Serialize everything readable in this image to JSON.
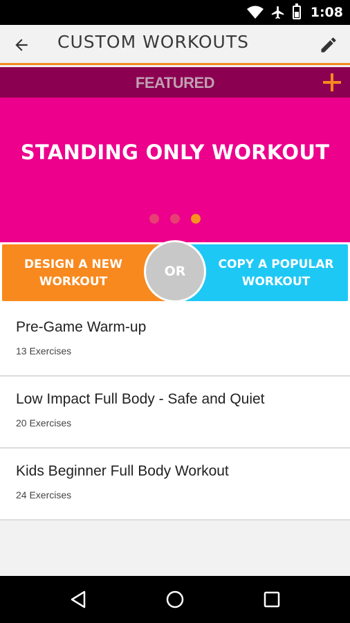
{
  "status_bar": {
    "time": "1:08",
    "icons": [
      "wifi-icon",
      "airplane-icon",
      "battery-icon"
    ]
  },
  "toolbar": {
    "title": "CUSTOM WORKOUTS",
    "back_icon": "arrow-left-icon",
    "edit_icon": "pencil-icon"
  },
  "featured": {
    "label": "FEATURED",
    "add_icon": "plus-icon",
    "banner_title": "STANDING ONLY WORKOUT",
    "carousel_pages": 3,
    "carousel_active_page": 3
  },
  "actions": {
    "design_label": "DESIGN A NEW\nWORKOUT",
    "or_label": "OR",
    "copy_label": "COPY A POPULAR\nWORKOUT"
  },
  "workouts": [
    {
      "name": "Pre-Game Warm-up",
      "count": "13 Exercises"
    },
    {
      "name": "Low Impact Full Body - Safe and Quiet",
      "count": "20 Exercises"
    },
    {
      "name": "Kids Beginner Full Body Workout",
      "count": "24 Exercises"
    }
  ],
  "nav_bar": {
    "icons": [
      "back-triangle-icon",
      "home-circle-icon",
      "recents-square-icon"
    ]
  },
  "colors": {
    "accent_orange": "#f7891e",
    "featured_bar": "#8c0051",
    "banner_pink": "#ec008c",
    "copy_blue": "#1ec8f5",
    "or_gray": "#c8c8c8"
  }
}
